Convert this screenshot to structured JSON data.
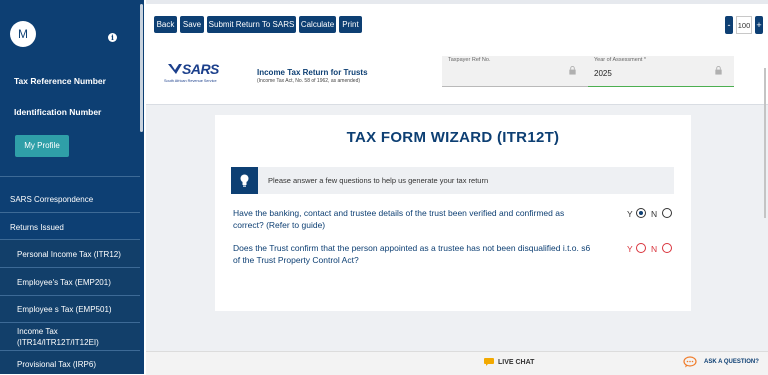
{
  "sidebar": {
    "avatar_initial": "M",
    "info_icon": "i",
    "tax_reference_label": "Tax Reference Number",
    "identification_label": "Identification Number",
    "profile_button": "My Profile",
    "items": [
      {
        "label": "SARS Correspondence"
      },
      {
        "label": "Returns Issued"
      },
      {
        "label": "Personal Income Tax (ITR12)"
      },
      {
        "label": "Employee's Tax (EMP201)"
      },
      {
        "label": "Employee s Tax (EMP501)"
      },
      {
        "label": "Income Tax"
      },
      {
        "label": "(ITR14/ITR12T/IT12EI)"
      },
      {
        "label": "Provisional Tax (IRP6)"
      }
    ]
  },
  "toolbar": {
    "back": "Back",
    "save": "Save",
    "submit": "Submit Return To SARS",
    "calculate": "Calculate",
    "print": "Print",
    "zoom_minus": "-",
    "zoom_value": "100",
    "zoom_plus": "+"
  },
  "header": {
    "logo_text": "SARS",
    "logo_subtext": "South African Revenue Service",
    "form_title": "Income Tax Return for Trusts",
    "form_subtitle": "(Income Tax Act, No. 58 of 1962, as amended)",
    "taxpayer_ref_label": "Taxpayer Ref No.",
    "taxpayer_ref_value": "",
    "year_label": "Year of Assessment *",
    "year_value": "2025"
  },
  "wizard": {
    "title": "TAX FORM WIZARD (ITR12T)",
    "notice": "Please answer a few questions to help us generate your tax return",
    "questions": [
      {
        "text": "Have the banking, contact and trustee details of the trust been verified and confirmed as correct? (Refer to guide)",
        "y_label": "Y",
        "n_label": "N",
        "selected": "Y"
      },
      {
        "text": "Does the Trust confirm that the person appointed as a trustee has not been disqualified i.t.o. s6 of the Trust Property Control Act?",
        "y_label": "Y",
        "n_label": "N",
        "selected": ""
      }
    ]
  },
  "footer": {
    "live_chat": "LIVE CHAT",
    "ask": "ASK A QUESTION?"
  },
  "colors": {
    "navy": "#0d3f73",
    "teal_button": "#2f9fa8",
    "required_red": "#d9333c"
  }
}
